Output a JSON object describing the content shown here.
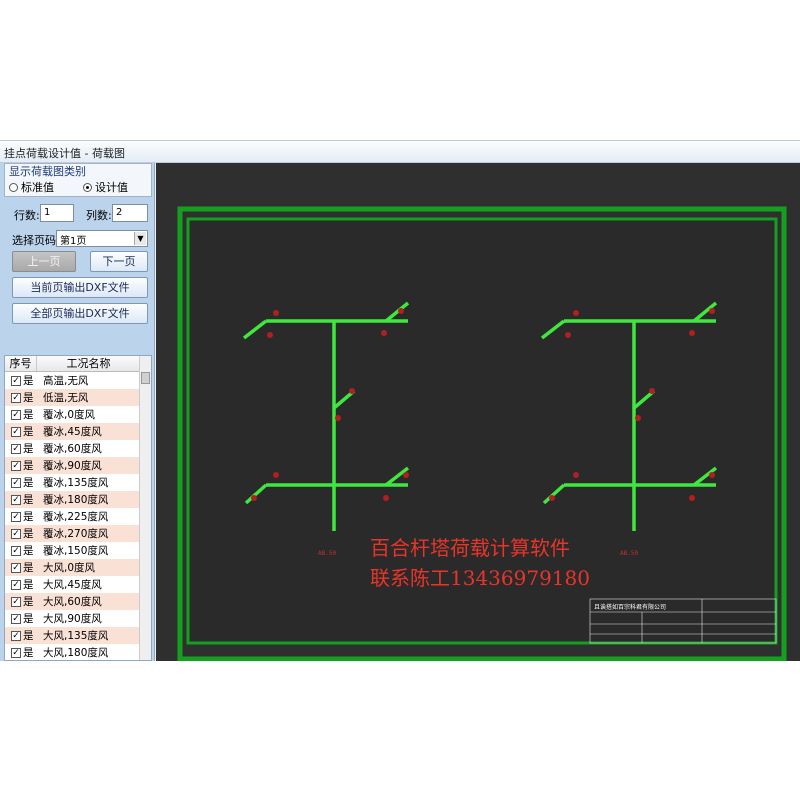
{
  "window": {
    "title": "挂点荷载设计值 - 荷载图"
  },
  "left": {
    "group_title": "显示荷载图类别",
    "radio_standard": "标准值",
    "radio_design": "设计值",
    "rows_label": "行数:",
    "rows_value": "1",
    "cols_label": "列数:",
    "cols_value": "2",
    "page_label": "选择页码",
    "page_value": "第1页",
    "prev_btn": "上一页",
    "next_btn": "下一页",
    "export_current": "当前页输出DXF文件",
    "export_all": "全部页输出DXF文件",
    "col_no": "序号",
    "col_name": "工况名称",
    "cases": [
      {
        "yes": "是",
        "name": "高温,无风"
      },
      {
        "yes": "是",
        "name": "低温,无风"
      },
      {
        "yes": "是",
        "name": "覆冰,0度风"
      },
      {
        "yes": "是",
        "name": "覆冰,45度风"
      },
      {
        "yes": "是",
        "name": "覆冰,60度风"
      },
      {
        "yes": "是",
        "name": "覆冰,90度风"
      },
      {
        "yes": "是",
        "name": "覆冰,135度风"
      },
      {
        "yes": "是",
        "name": "覆冰,180度风"
      },
      {
        "yes": "是",
        "name": "覆冰,225度风"
      },
      {
        "yes": "是",
        "name": "覆冰,270度风"
      },
      {
        "yes": "是",
        "name": "覆冰,150度风"
      },
      {
        "yes": "是",
        "name": "大风,0度风"
      },
      {
        "yes": "是",
        "name": "大风,45度风"
      },
      {
        "yes": "是",
        "name": "大风,60度风"
      },
      {
        "yes": "是",
        "name": "大风,90度风"
      },
      {
        "yes": "是",
        "name": "大风,135度风"
      },
      {
        "yes": "是",
        "name": "大风,180度风"
      }
    ]
  },
  "drawing": {
    "tower_label_left": "AB.50",
    "tower_label_right": "AB.50",
    "titleblock_company": "且诶搭如百宗科君有限公司"
  },
  "watermark": {
    "line1": "百合杆塔荷载计算软件",
    "line2": "联系陈工13436979180"
  },
  "colors": {
    "frame_green": "#14a01e",
    "member_green": "#3ee83e",
    "node_red": "#b02020",
    "watermark_red": "#e8352a"
  }
}
